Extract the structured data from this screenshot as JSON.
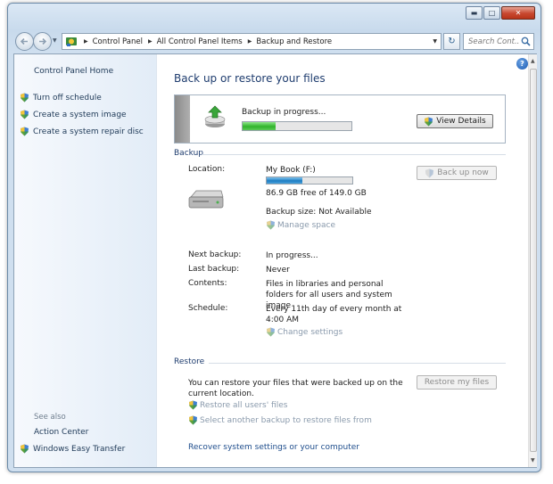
{
  "breadcrumb": [
    "Control Panel",
    "All Control Panel Items",
    "Backup and Restore"
  ],
  "search": {
    "placeholder": "Search Cont..."
  },
  "sidebar": {
    "home": "Control Panel Home",
    "links": [
      "Turn off schedule",
      "Create a system image",
      "Create a system repair disc"
    ],
    "see_also": "See also",
    "see_also_links": [
      "Action Center",
      "Windows Easy Transfer"
    ]
  },
  "main": {
    "title": "Back up or restore your files",
    "progress": {
      "label": "Backup in progress...",
      "fraction": 0.3,
      "button": "View Details"
    },
    "backup": {
      "heading": "Backup",
      "location_label": "Location:",
      "location_value": "My Book (F:)",
      "disk_used_fraction": 0.42,
      "free_space": "86.9 GB free of 149.0 GB",
      "backup_size": "Backup size: Not Available",
      "manage_space": "Manage space",
      "back_up_now": "Back up now",
      "next_label": "Next backup:",
      "next_value": "In progress...",
      "last_label": "Last backup:",
      "last_value": "Never",
      "contents_label": "Contents:",
      "contents_value": "Files in libraries and personal folders for all users and system image",
      "schedule_label": "Schedule:",
      "schedule_value": "Every 11th day of every month at 4:00 AM",
      "change_settings": "Change settings"
    },
    "restore": {
      "heading": "Restore",
      "text": "You can restore your files that were backed up on the current location.",
      "restore_all": "Restore all users' files",
      "select_another": "Select another backup to restore files from",
      "restore_button": "Restore my files",
      "recover_link": "Recover system settings or your computer"
    }
  },
  "colors": {
    "link": "#1e3957",
    "heading": "#1e3c6e",
    "progress_green": "#2fb32a",
    "disk_blue": "#1e7dc2"
  },
  "icons": [
    "back-arrow-icon",
    "forward-arrow-icon",
    "control-panel-icon",
    "refresh-icon",
    "search-icon",
    "help-icon",
    "uac-shield-icon",
    "backup-icon",
    "hard-drive-icon"
  ]
}
